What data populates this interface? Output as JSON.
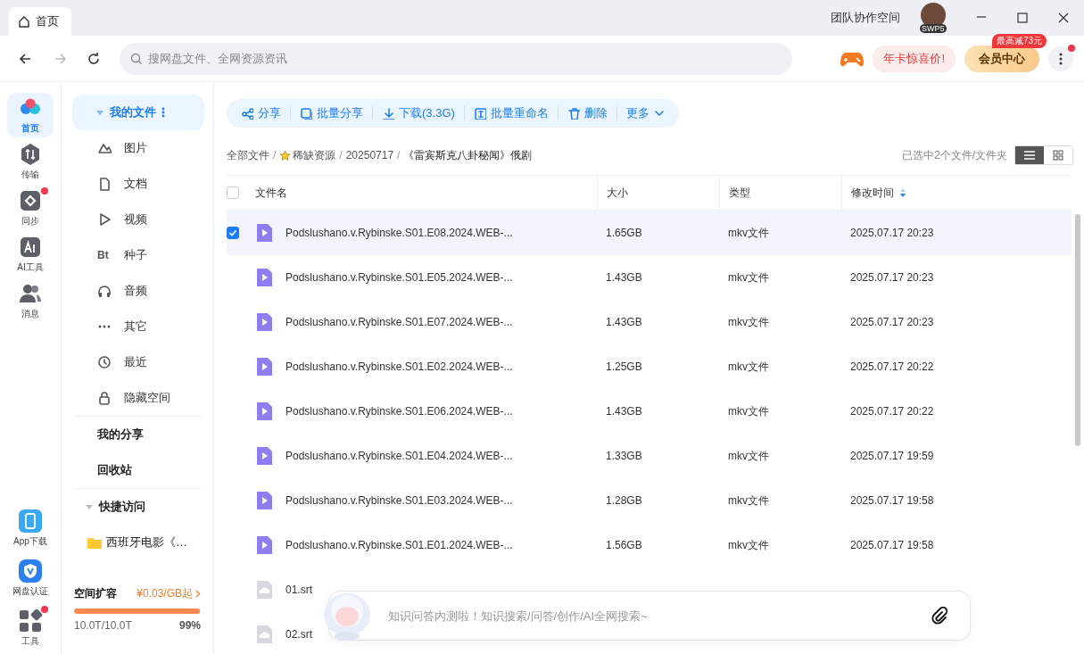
{
  "tab": {
    "label": "首页",
    "selected": true
  },
  "title_bar": {
    "team_space": "团队协作空间",
    "avatar_badge": "SWP5"
  },
  "nav": {
    "search_placeholder": "搜网盘文件、全网资源资讯",
    "promo": "年卡惊喜价!",
    "vip_button": "会员中心",
    "vip_badge": "最高减73元",
    "menu_dot": true
  },
  "rail": [
    {
      "label": "首页",
      "selected": true,
      "dot": false
    },
    {
      "label": "传输",
      "selected": false,
      "dot": false
    },
    {
      "label": "同步",
      "selected": false,
      "dot": true
    },
    {
      "label": "AI工具",
      "selected": false,
      "dot": false
    },
    {
      "label": "消息",
      "selected": false,
      "dot": false
    }
  ],
  "rail_bottom": [
    {
      "label": "App下载",
      "dot": false
    },
    {
      "label": "网盘认证",
      "dot": false
    },
    {
      "label": "工具",
      "dot": true
    }
  ],
  "sidebar": {
    "my_files": {
      "label": "我的文件",
      "expanded": true
    },
    "categories": [
      {
        "label": "图片"
      },
      {
        "label": "文档"
      },
      {
        "label": "视频"
      },
      {
        "icon_text": "Bt",
        "label": "种子"
      },
      {
        "label": "音频"
      },
      {
        "label": "其它"
      },
      {
        "label": "最近"
      },
      {
        "label": "隐藏空间"
      }
    ],
    "links": [
      "我的分享",
      "回收站"
    ],
    "quick_access": {
      "label": "快捷访问",
      "expanded": true,
      "items": [
        "西班牙电影《…"
      ]
    }
  },
  "storage": {
    "title": "空间扩容",
    "price": "¥0.03/GB起",
    "usage": "10.0T/10.0T",
    "percent": "99%",
    "level": 0.99
  },
  "toolbar": [
    {
      "kind": "action",
      "label": "分享"
    },
    {
      "kind": "action",
      "label": "批量分享"
    },
    {
      "kind": "action",
      "label": "下载(3.3G)"
    },
    {
      "kind": "action",
      "label": "批量重命名"
    },
    {
      "kind": "action",
      "label": "删除"
    },
    {
      "kind": "dropdown",
      "label": "更多"
    }
  ],
  "breadcrumb": {
    "separator": "/",
    "items": [
      {
        "label": "全部文件",
        "starred": false
      },
      {
        "label": "稀缺资源",
        "starred": true
      },
      {
        "label": "20250717",
        "starred": false
      },
      {
        "label": "《雷宾斯克八卦秘闻》俄剧",
        "starred": false
      }
    ]
  },
  "selection_info": "已选中2个文件/文件夹",
  "view_buttons": [
    {
      "kind": "list",
      "selected": true
    },
    {
      "kind": "grid",
      "selected": false
    }
  ],
  "table": {
    "select_all": {
      "checked": false
    },
    "columns": [
      "文件名",
      "大小",
      "类型",
      "修改时间"
    ],
    "rows": [
      {
        "kind": "video",
        "name": "Podslushano.v.Rybinske.S01.E08.2024.WEB-...",
        "size": "1.65GB",
        "type": "mkv文件",
        "modified": "2025.07.17 20:23",
        "selected": true
      },
      {
        "kind": "video",
        "name": "Podslushano.v.Rybinske.S01.E05.2024.WEB-...",
        "size": "1.43GB",
        "type": "mkv文件",
        "modified": "2025.07.17 20:23",
        "selected": false
      },
      {
        "kind": "video",
        "name": "Podslushano.v.Rybinske.S01.E07.2024.WEB-...",
        "size": "1.43GB",
        "type": "mkv文件",
        "modified": "2025.07.17 20:23",
        "selected": false
      },
      {
        "kind": "video",
        "name": "Podslushano.v.Rybinske.S01.E02.2024.WEB-...",
        "size": "1.25GB",
        "type": "mkv文件",
        "modified": "2025.07.17 20:22",
        "selected": false
      },
      {
        "kind": "video",
        "name": "Podslushano.v.Rybinske.S01.E06.2024.WEB-...",
        "size": "1.43GB",
        "type": "mkv文件",
        "modified": "2025.07.17 20:22",
        "selected": false
      },
      {
        "kind": "video",
        "name": "Podslushano.v.Rybinske.S01.E04.2024.WEB-...",
        "size": "1.33GB",
        "type": "mkv文件",
        "modified": "2025.07.17 19:59",
        "selected": false
      },
      {
        "kind": "video",
        "name": "Podslushano.v.Rybinske.S01.E03.2024.WEB-...",
        "size": "1.28GB",
        "type": "mkv文件",
        "modified": "2025.07.17 19:58",
        "selected": false
      },
      {
        "kind": "video",
        "name": "Podslushano.v.Rybinske.S01.E01.2024.WEB-...",
        "size": "1.56GB",
        "type": "mkv文件",
        "modified": "2025.07.17 19:58",
        "selected": false
      },
      {
        "kind": "subtitle",
        "name": "01.srt",
        "selected": false
      },
      {
        "kind": "subtitle",
        "name": "02.srt",
        "selected": false
      }
    ]
  },
  "assistant": {
    "placeholder": "知识问答内测啦！知识搜索/问答/创作/AI全网搜索~"
  }
}
